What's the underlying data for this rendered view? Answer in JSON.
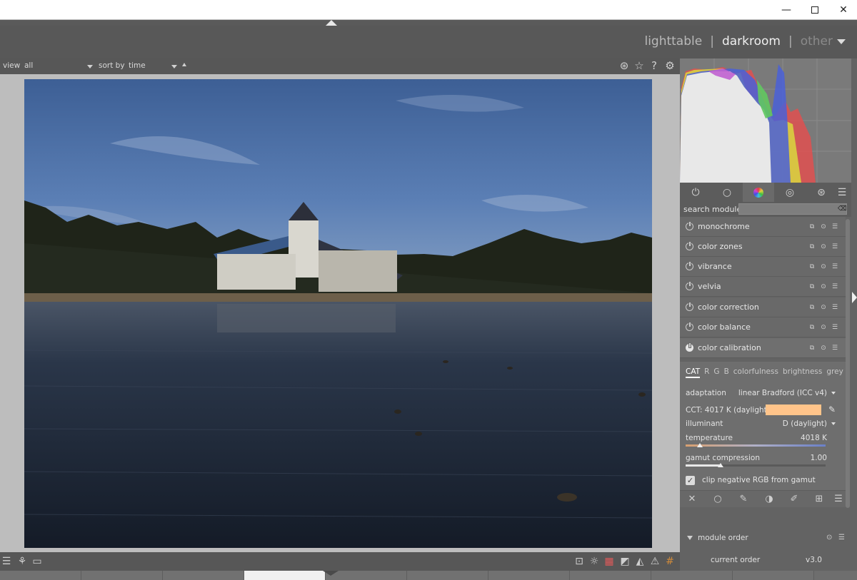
{
  "window": {
    "minimize_glyph": "—",
    "maximize_glyph": "",
    "close_glyph": "✕"
  },
  "header": {
    "views": [
      "lighttable",
      "darkroom",
      "other"
    ],
    "separator": "|"
  },
  "filterbar": {
    "view_label": "view",
    "view_value": "all",
    "sort_label": "sort by",
    "sort_value": "time"
  },
  "module_tabs": [
    "power",
    "circle",
    "color",
    "correct",
    "effect",
    "presets"
  ],
  "search": {
    "label": "search module",
    "placeholder": ""
  },
  "modules": [
    {
      "name": "monochrome"
    },
    {
      "name": "color zones"
    },
    {
      "name": "vibrance"
    },
    {
      "name": "velvia"
    },
    {
      "name": "color correction"
    },
    {
      "name": "color balance"
    },
    {
      "name": "color calibration"
    }
  ],
  "color_calibration": {
    "tabs": [
      "CAT",
      "R",
      "G",
      "B",
      "colorfulness",
      "brightness",
      "grey"
    ],
    "active_tab": "CAT",
    "adaptation_label": "adaptation",
    "adaptation_value": "linear Bradford (ICC v4)",
    "cct_label": "CCT: 4017 K (daylight)",
    "cct_swatch_color": "#ffc48a",
    "illuminant_label": "illuminant",
    "illuminant_value": "D (daylight)",
    "temperature_label": "temperature",
    "temperature_value": "4018 K",
    "temperature_position": 0.1,
    "gamut_label": "gamut compression",
    "gamut_value": "1.00",
    "gamut_position": 0.25,
    "clip_label": "clip negative RGB from gamut",
    "clip_checked": true
  },
  "module_order": {
    "title": "module order",
    "current_label": "current order",
    "current_value": "v3.0"
  }
}
